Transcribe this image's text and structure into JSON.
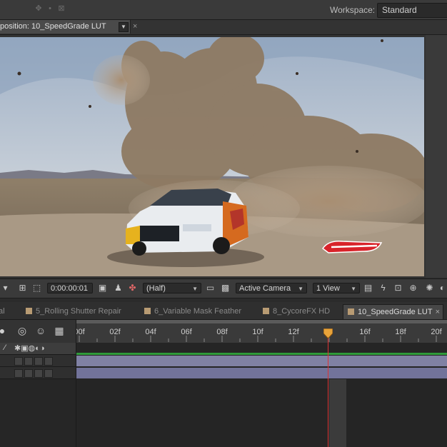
{
  "topbar": {
    "workspace_label": "Workspace:",
    "workspace_value": "Standard"
  },
  "composition_tab": {
    "label": "position: 10_SpeedGrade LUT",
    "menu_arrow": "▼",
    "close": "×"
  },
  "viewer": {
    "watermark_text": "HOT WHEELS"
  },
  "viewer_toolbar": {
    "timecode": "0:00:00:01",
    "resolution": "(Half)",
    "camera": "Active Camera",
    "views": "1 View"
  },
  "timeline_tabs": [
    {
      "label": "5_Rolling Shutter Repair",
      "active": false
    },
    {
      "label": "6_Variable Mask Feather",
      "active": false
    },
    {
      "label": "8_CycoreFX HD",
      "active": false
    },
    {
      "label": "10_SpeedGrade LUT",
      "active": true
    }
  ],
  "ruler": {
    "labels": [
      "00f",
      "02f",
      "04f",
      "06f",
      "08f",
      "10f",
      "12f",
      "16f",
      "18f",
      "20f"
    ],
    "current_frame": 14
  },
  "colors": {
    "accent_green": "#2f9a3b",
    "layer_bar": "#8081a4",
    "playhead": "#dd3333",
    "label_swatch": "#b89b73"
  }
}
